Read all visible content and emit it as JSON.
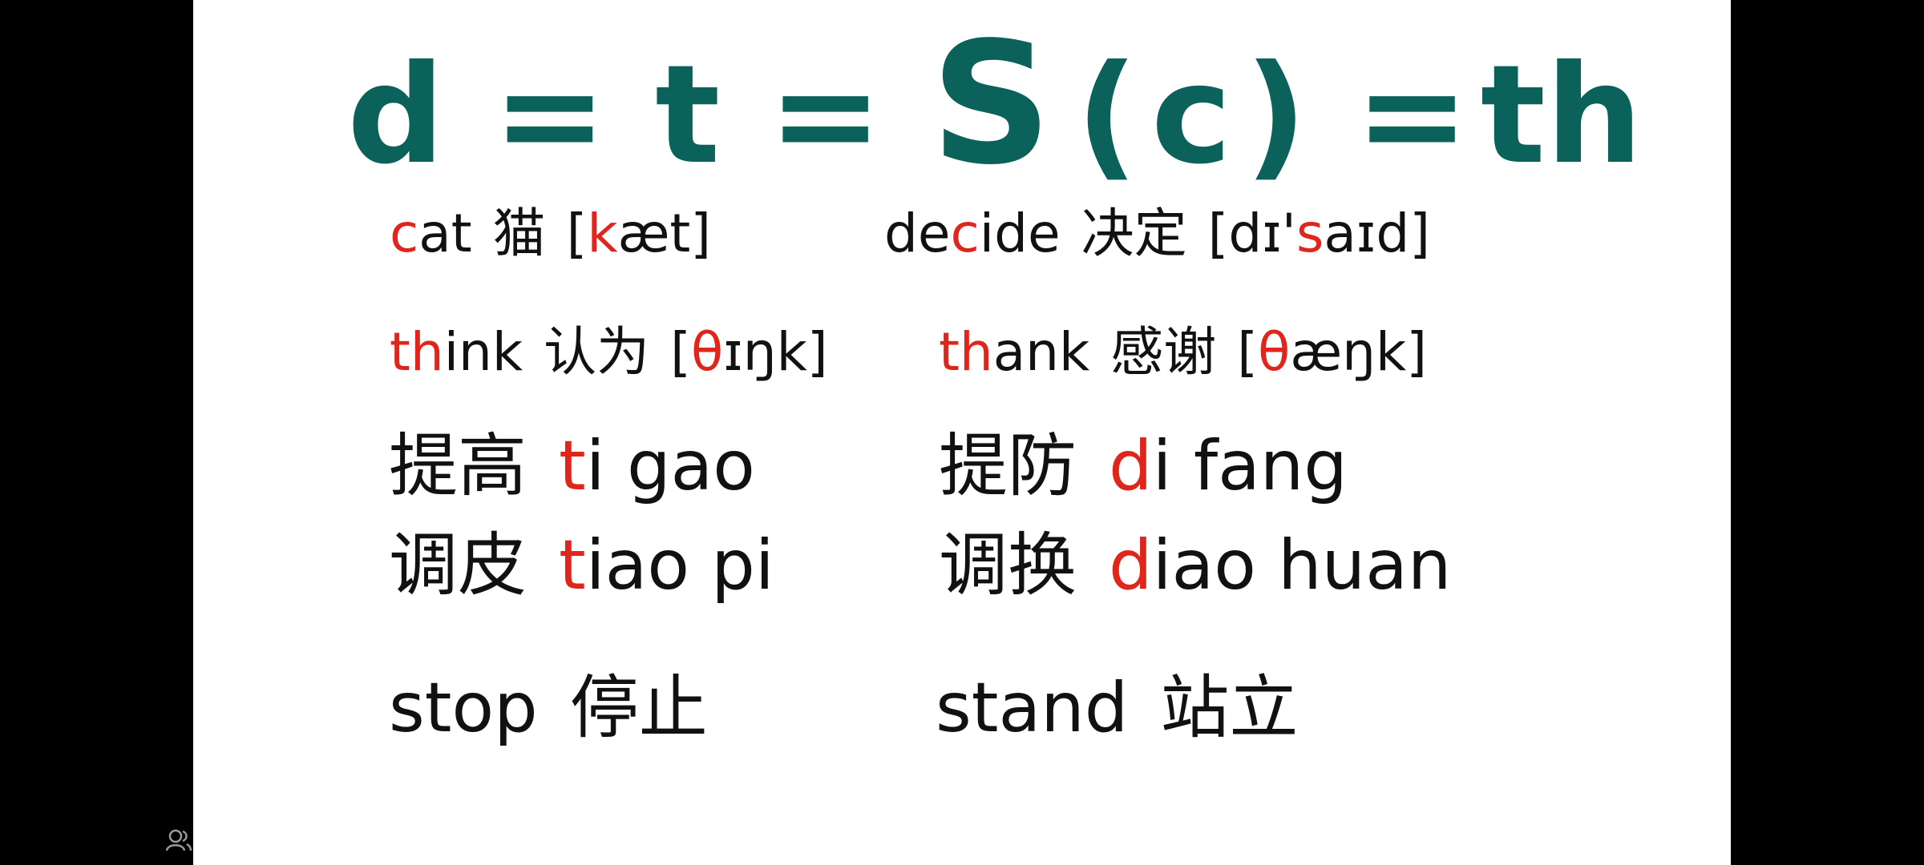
{
  "title": {
    "d": "d",
    "eq1": "=",
    "t": "t",
    "eq2": "=",
    "s": "S",
    "paren_open": "(",
    "c": "c",
    "paren_close": ")",
    "eq3": "=",
    "th": "th"
  },
  "examples": {
    "cat": {
      "word_red": "c",
      "word_rest": "at",
      "chinese": "猫",
      "ipa_open": "[",
      "ipa_red": "k",
      "ipa_rest": "æt]"
    },
    "decide": {
      "word_pre": "de",
      "word_red": "c",
      "word_rest": "ide",
      "chinese": "决定",
      "ipa_pre": "[dɪ'",
      "ipa_red": "s",
      "ipa_rest": "aɪd]"
    },
    "think": {
      "word_red": "th",
      "word_rest": "ink",
      "chinese": "认为",
      "ipa_open": "[",
      "ipa_red": "θ",
      "ipa_rest": "ɪŋk]"
    },
    "thank": {
      "word_red": "th",
      "word_rest": "ank",
      "chinese": "感谢",
      "ipa_open": "[",
      "ipa_red": "θ",
      "ipa_rest": "æŋk]"
    },
    "tigao": {
      "chinese": "提高",
      "pinyin_red": "t",
      "pinyin_rest": "i gao"
    },
    "difang": {
      "chinese": "提防",
      "pinyin_red": "d",
      "pinyin_rest": "i fang"
    },
    "tiaopi": {
      "chinese": "调皮",
      "pinyin_red": "t",
      "pinyin_rest": "iao pi"
    },
    "diaohuan": {
      "chinese": "调换",
      "pinyin_red": "d",
      "pinyin_rest": "iao huan"
    },
    "stop": {
      "word": "stop",
      "chinese": "停止"
    },
    "stand": {
      "word": "stand",
      "chinese": "站立"
    }
  },
  "colors": {
    "title": "#0b625a",
    "highlight": "#e0251c",
    "text": "#111111",
    "background": "#ffffff",
    "letterbox": "#000000"
  },
  "icons": {
    "corner": "user-icon"
  }
}
